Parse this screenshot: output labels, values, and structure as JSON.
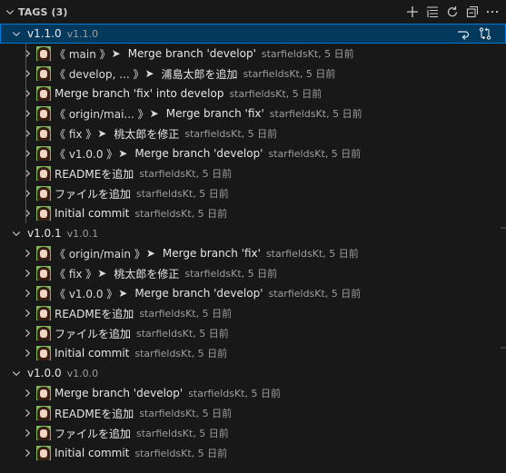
{
  "header": {
    "title": "TAGS (3)"
  },
  "toolbar": {
    "icons": [
      "add-icon",
      "list-view-icon",
      "refresh-icon",
      "collapse-all-icon",
      "more-icon"
    ]
  },
  "tags": [
    {
      "name": "v1.1.0",
      "desc": "v1.1.0",
      "selected": true,
      "expanded": true,
      "commits": [
        {
          "refs": "《 main 》",
          "message": "Merge branch 'develop'",
          "meta": "starfieldsKt, 5 日前"
        },
        {
          "refs": "《 develop, ... 》",
          "message": "浦島太郎を追加",
          "meta": "starfieldsKt, 5 日前"
        },
        {
          "refs": "",
          "message": "Merge branch 'fix' into develop",
          "meta": "starfieldsKt, 5 日前"
        },
        {
          "refs": "《 origin/mai... 》",
          "message": "Merge branch 'fix'",
          "meta": "starfieldsKt, 5 日前"
        },
        {
          "refs": "《 fix 》",
          "message": "桃太郎を修正",
          "meta": "starfieldsKt, 5 日前"
        },
        {
          "refs": "《 v1.0.0 》",
          "message": "Merge branch 'develop'",
          "meta": "starfieldsKt, 5 日前"
        },
        {
          "refs": "",
          "message": "READMEを追加",
          "meta": "starfieldsKt, 5 日前"
        },
        {
          "refs": "",
          "message": "ファイルを追加",
          "meta": "starfieldsKt, 5 日前"
        },
        {
          "refs": "",
          "message": "Initial commit",
          "meta": "starfieldsKt, 5 日前"
        }
      ]
    },
    {
      "name": "v1.0.1",
      "desc": "v1.0.1",
      "selected": false,
      "expanded": true,
      "commits": [
        {
          "refs": "《 origin/main 》",
          "message": "Merge branch 'fix'",
          "meta": "starfieldsKt, 5 日前"
        },
        {
          "refs": "《 fix 》",
          "message": "桃太郎を修正",
          "meta": "starfieldsKt, 5 日前"
        },
        {
          "refs": "《 v1.0.0 》",
          "message": "Merge branch 'develop'",
          "meta": "starfieldsKt, 5 日前"
        },
        {
          "refs": "",
          "message": "READMEを追加",
          "meta": "starfieldsKt, 5 日前"
        },
        {
          "refs": "",
          "message": "ファイルを追加",
          "meta": "starfieldsKt, 5 日前"
        },
        {
          "refs": "",
          "message": "Initial commit",
          "meta": "starfieldsKt, 5 日前"
        }
      ]
    },
    {
      "name": "v1.0.0",
      "desc": "v1.0.0",
      "selected": false,
      "expanded": true,
      "commits": [
        {
          "refs": "",
          "message": "Merge branch 'develop'",
          "meta": "starfieldsKt, 5 日前"
        },
        {
          "refs": "",
          "message": "READMEを追加",
          "meta": "starfieldsKt, 5 日前"
        },
        {
          "refs": "",
          "message": "ファイルを追加",
          "meta": "starfieldsKt, 5 日前"
        },
        {
          "refs": "",
          "message": "Initial commit",
          "meta": "starfieldsKt, 5 日前"
        }
      ]
    }
  ],
  "tag_actions": [
    "switch-to-icon",
    "compare-icon"
  ],
  "colors": {
    "selected_bg": "#04395e",
    "focus_border": "#0078d4",
    "avatar_bg": "#7fb65a"
  }
}
